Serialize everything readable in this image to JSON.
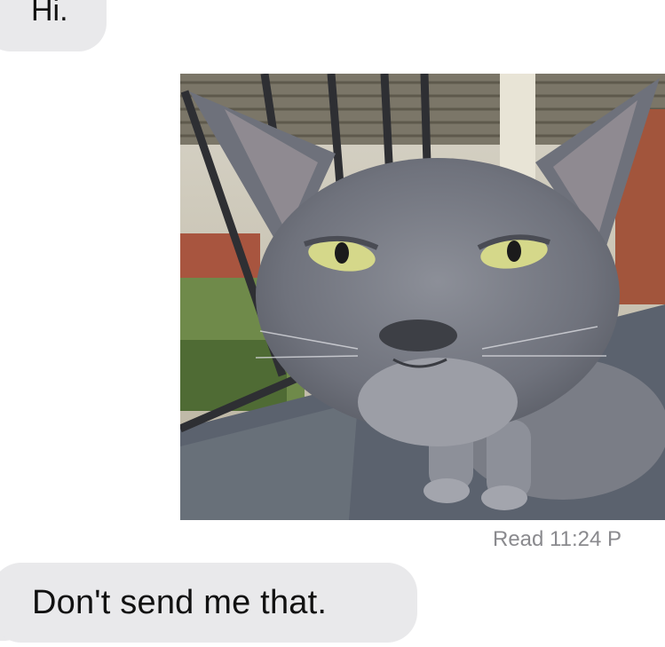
{
  "messages": [
    {
      "direction": "incoming",
      "text": "Hi."
    },
    {
      "direction": "outgoing",
      "type": "image",
      "image_name": "cat-photo"
    },
    {
      "direction": "incoming",
      "text": "Don't send me that."
    }
  ],
  "read_receipt": {
    "text": "Read 11:24 P"
  },
  "colors": {
    "incoming_bubble": "#e9e9eb",
    "text": "#111111",
    "receipt": "#8a8a8e",
    "background": "#ffffff"
  }
}
